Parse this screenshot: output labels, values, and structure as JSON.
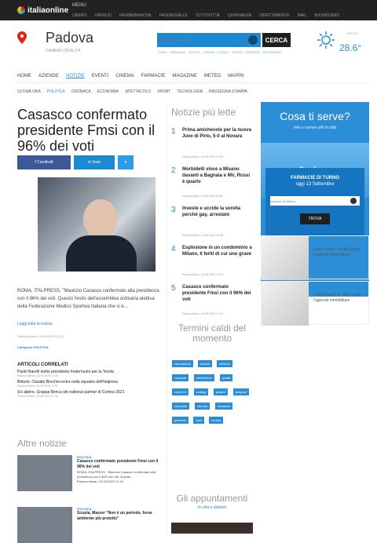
{
  "topbar": {
    "logo": "italiaonline",
    "menu_label": "MENU",
    "links": [
      "LIBERO",
      "VIRGILIO",
      "PAGINEBIANCHE",
      "PAGINEGIALLE",
      "TUTTOCITTÀ",
      "QUIFINANZA",
      "DIRETTAMENTE",
      "MAIL",
      "BUONISSIMO"
    ]
  },
  "header": {
    "city": "Padova",
    "change_city": "CAMBIA LOCALITÀ",
    "search": {
      "placeholder": "Cerca in città"
    },
    "cerca_label": "CERCA",
    "quick_links": "AREE · FARMACIE · METEO · CINEMA · EVENTI · TEATRI · PIZZERIE · RISTORANTI",
    "weather": {
      "label": "METEO",
      "temp": "28.6°"
    }
  },
  "main_nav": {
    "items": [
      "HOME",
      "AZIENDE",
      "NOTIZIE",
      "EVENTI",
      "CINEMA",
      "FARMACIE",
      "MAGAZINE",
      "METEO",
      "MAPPA"
    ],
    "active": "NOTIZIE"
  },
  "sub_nav": {
    "items": [
      "ULTIMA ORA",
      "POLITICA",
      "CRONACA",
      "ECONOMIA",
      "SPETTACOLO",
      "SPORT",
      "TECNOLOGIA",
      "RASSEGNA STAMPA"
    ],
    "active": "POLITICA"
  },
  "article": {
    "title": "Casasco confermato presidente Fmsi con il 96% dei voti",
    "share": {
      "facebook": "Condividi",
      "messenger": "Invia",
      "twitter": ""
    },
    "body": "ROMA, ITALPRESS, \"Maurizio Casasco confermato alla presidenza con il 96% dei voti. Questo l'esito dell'assemblea ordinaria elettiva della Federazione Medico Sportiva Italiana che si è...",
    "read_more": "Leggi tutta la notizia",
    "meta": "Padova News | 13.09.2020 17:24",
    "category_label": "Categoria:",
    "category_value": "POLITICA"
  },
  "related": {
    "title": "ARTICOLI CORRELATI",
    "items": [
      {
        "title": "Paolo Barelli eletto presidente Federnuoto per la Tevola",
        "meta": "Padova News | 13.09.2020 17:30"
      },
      {
        "title": "Bitturio, Claudio Brochini entra nella squadra dell'Italpress",
        "meta": "Padova News | 13.09.2020 17:40"
      },
      {
        "title": "Sci alpino, Grappa Benca ufo national partner di Cortina 2021",
        "meta": "Padova News | 13.09.2020 17:45"
      }
    ]
  },
  "altre": {
    "title": "Altre notizie",
    "cards": [
      {
        "category": "POLITICA",
        "title": "Casasco confermato presidente Fmsi con il 96% dei voti",
        "excerpt": "ROMA, ITALPRESS, \"Maurizio Casasco confermato alla presidenza con il 96% dei voti. Questo...",
        "meta": "Padova News | 13.09.2020 17:24"
      },
      {
        "category": "POLITICA",
        "title": "Scuola, Mazzer \"Non è un periodo, forse ambiente più protetto\"",
        "excerpt": "",
        "meta": ""
      }
    ]
  },
  "most_read": {
    "title": "Notizie più lette",
    "items": [
      {
        "n": "1",
        "title": "Prima amichevole per la nuova Juve di Pirlo, 5-0 al Novara",
        "meta": "Padova News | 13.09.2020 17:38"
      },
      {
        "n": "2",
        "title": "Morbidelli vince a Misano davanti a Bagnaia e Mir, Rossi è quarto",
        "meta": "Padova News | 13.09.2020 15:55"
      },
      {
        "n": "3",
        "title": "Investe e uccide la sorella perchè gay, arrestato",
        "meta": "Padova News | 13.09.2020 13:08"
      },
      {
        "n": "4",
        "title": "Esplosione in un condominio a Milano, 6 feriti di cui uno grave",
        "meta": "Padova News | 13.09.2020 14:05"
      },
      {
        "n": "5",
        "title": "Casasco confermato presidente Fmsi con il 96% dei voti",
        "meta": "Padova News | 13.09.2020 17:24"
      }
    ]
  },
  "termini": {
    "title": "Termini caldi del momento",
    "tags": [
      "coronavirus",
      "scuola",
      "elezioni",
      "regionali",
      "referendum",
      "sanità",
      "covid-19",
      "contagi",
      "positivi",
      "tamponi",
      "ospedale",
      "vaccino",
      "lockdown",
      "juventus",
      "zaia",
      "veneto"
    ]
  },
  "appuntamenti": {
    "title": "Gli appuntamenti",
    "subtitle": "in città e dintorni"
  },
  "sidebar": {
    "cosa_title": "Cosa ti serve?",
    "cosa_sub": "Info e numeri utili in città",
    "city_banner": "Padova",
    "farmacie": {
      "title": "FARMACIE DI TURNO",
      "date": "oggi 13 Settembre",
      "input_placeholder": "Inserisci l'indirizzo",
      "trova_label": "TROVA"
    },
    "ads": [
      {
        "text": "Cerchi casa? In città scegli l'agenzia immobiliare"
      },
      {
        "text": "Cerchi casa? In città scegli l'agenzia immobiliare"
      }
    ]
  }
}
